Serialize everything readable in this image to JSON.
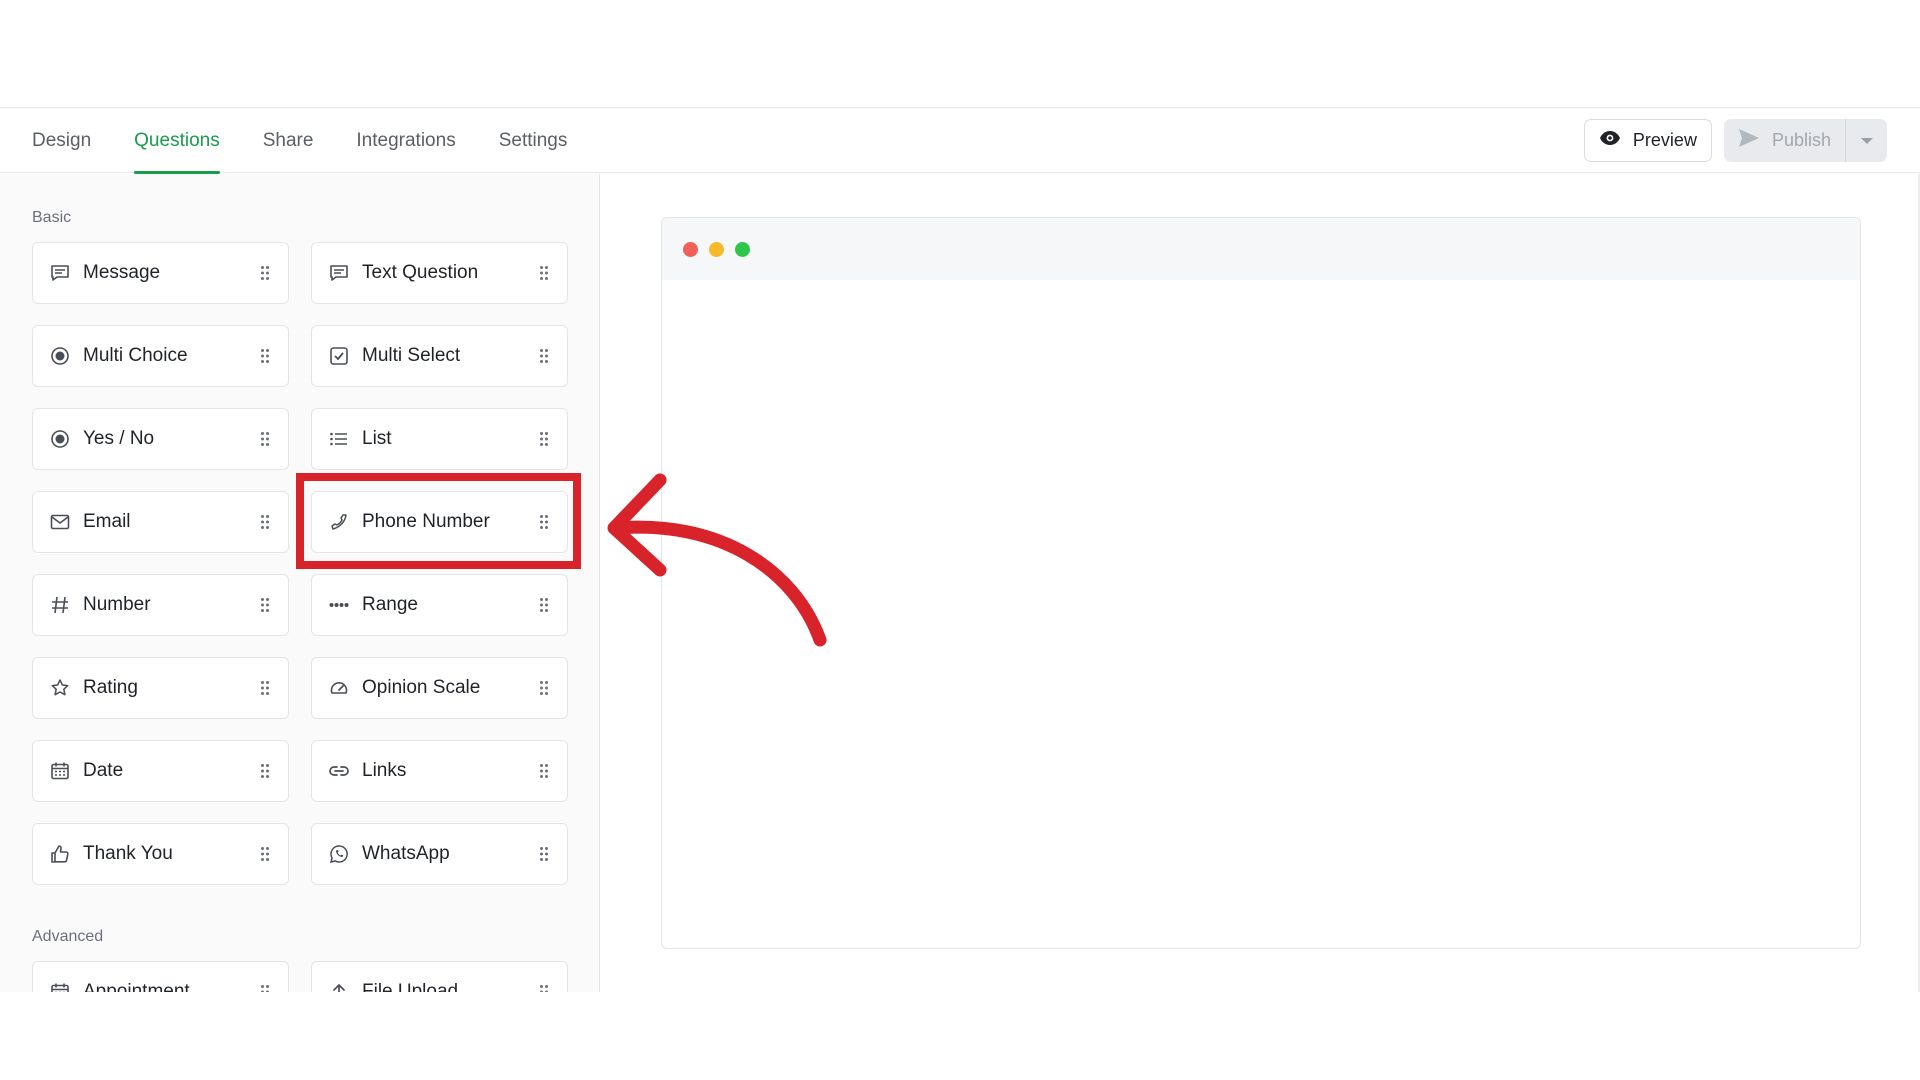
{
  "nav": {
    "tabs": [
      {
        "label": "Design"
      },
      {
        "label": "Questions"
      },
      {
        "label": "Share"
      },
      {
        "label": "Integrations"
      },
      {
        "label": "Settings"
      }
    ],
    "active_tab": "Questions",
    "preview_label": "Preview",
    "publish_label": "Publish"
  },
  "sidebar": {
    "basic_label": "Basic",
    "advanced_label": "Advanced",
    "basic_items": [
      {
        "label": "Message",
        "icon": "message-icon"
      },
      {
        "label": "Text Question",
        "icon": "message-icon"
      },
      {
        "label": "Multi Choice",
        "icon": "radio-icon"
      },
      {
        "label": "Multi Select",
        "icon": "checkbox-icon"
      },
      {
        "label": "Yes / No",
        "icon": "radio-icon"
      },
      {
        "label": "List",
        "icon": "list-icon"
      },
      {
        "label": "Email",
        "icon": "mail-icon"
      },
      {
        "label": "Phone Number",
        "icon": "phone-icon"
      },
      {
        "label": "Number",
        "icon": "hash-icon"
      },
      {
        "label": "Range",
        "icon": "range-icon"
      },
      {
        "label": "Rating",
        "icon": "star-icon"
      },
      {
        "label": "Opinion Scale",
        "icon": "gauge-icon"
      },
      {
        "label": "Date",
        "icon": "calendar-icon"
      },
      {
        "label": "Links",
        "icon": "link-icon"
      },
      {
        "label": "Thank You",
        "icon": "thumbs-up-icon"
      },
      {
        "label": "WhatsApp",
        "icon": "whatsapp-icon"
      }
    ],
    "advanced_items": [
      {
        "label": "Appointment",
        "icon": "calendar-icon"
      },
      {
        "label": "File Upload",
        "icon": "upload-icon"
      }
    ]
  },
  "colors": {
    "accent": "#1a9a4b",
    "highlight": "#d8232a",
    "dot_red": "#f25f58",
    "dot_yellow": "#f7b92c",
    "dot_green": "#2ec74a"
  }
}
